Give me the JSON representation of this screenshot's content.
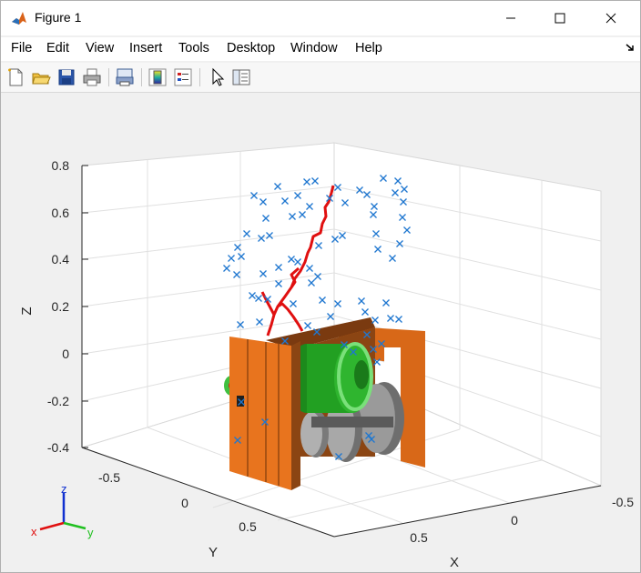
{
  "window": {
    "title": "Figure 1",
    "controls": {
      "minimize": "minimize",
      "maximize": "maximize",
      "close": "close"
    }
  },
  "menu": {
    "items": [
      "File",
      "Edit",
      "View",
      "Insert",
      "Tools",
      "Desktop",
      "Window",
      "Help"
    ]
  },
  "toolbar": {
    "buttons": [
      "new-figure",
      "open-file",
      "save-figure",
      "print-figure",
      "print-preview",
      "insert-colorbar",
      "insert-legend",
      "edit-plot",
      "property-inspector"
    ]
  },
  "axes": {
    "zlabel": "Z",
    "ylabel": "Y",
    "xlabel": "X",
    "z_ticks": [
      "0.8",
      "0.6",
      "0.4",
      "0.2",
      "0",
      "-0.2",
      "-0.4"
    ],
    "y_ticks": [
      "-0.5",
      "0",
      "0.5"
    ],
    "x_ticks": [
      "-0.5",
      "0",
      "0.5"
    ],
    "grid": true
  },
  "triad": {
    "z": "z",
    "x": "x",
    "y": "y"
  },
  "colors": {
    "scatter": "#1f77d0",
    "path": "#e01010",
    "frame": "#e8741e",
    "gear_green": "#21a121",
    "disc_gray": "#8c8c8c",
    "triad_x": "#e01010",
    "triad_y": "#20c020",
    "triad_z": "#1030d0"
  }
}
